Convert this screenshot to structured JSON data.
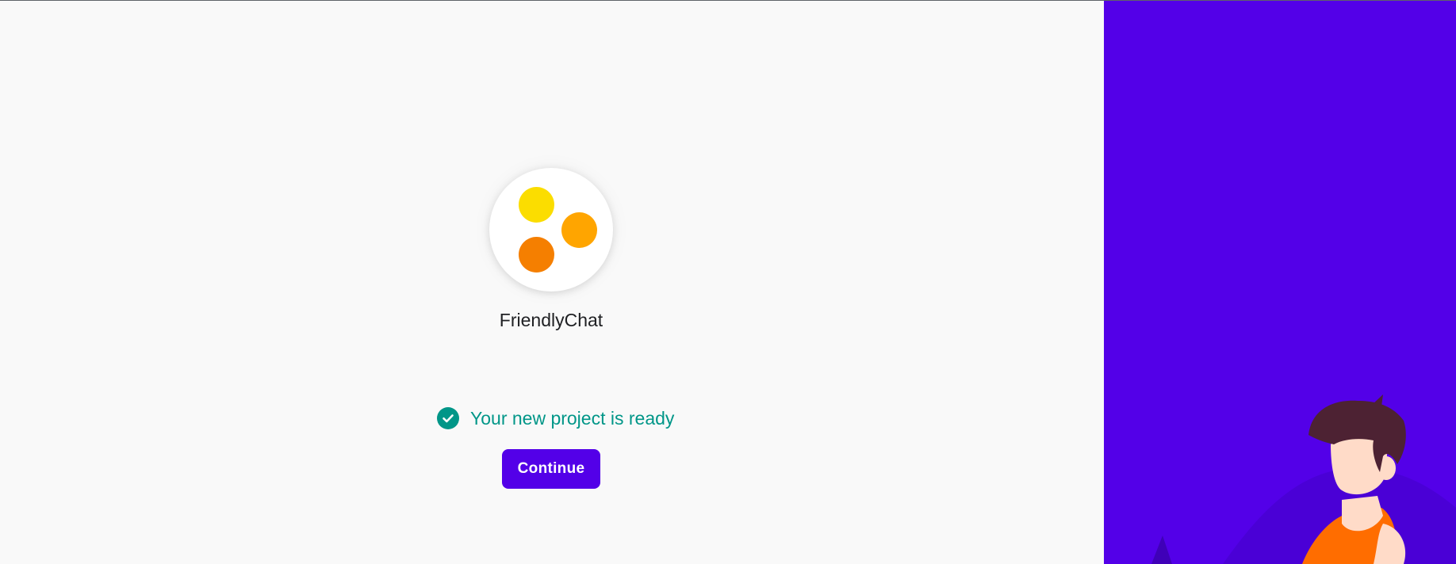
{
  "project": {
    "name": "FriendlyChat",
    "logo_icon": "three-dots-logo-icon"
  },
  "status": {
    "icon": "check-circle-icon",
    "text": "Your new project is ready"
  },
  "actions": {
    "continue_label": "Continue"
  },
  "illustration": {
    "subject": "person-illustration"
  },
  "colors": {
    "accent": "#5300e8",
    "success": "#009688",
    "logo_yellow": "#fbdd00",
    "logo_amber": "#ffa500",
    "logo_orange": "#f57f00",
    "page_background": "#f9f9f9"
  }
}
